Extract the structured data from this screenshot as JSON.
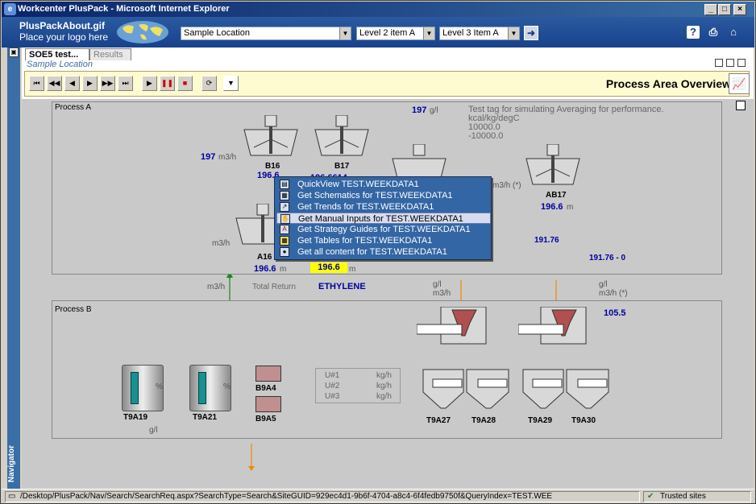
{
  "window": {
    "title": "Workcenter PlusPack - Microsoft Internet Explorer"
  },
  "header": {
    "logo_file": "PlusPackAbout.gif",
    "logo_text": "Place your logo here",
    "location": "Sample Location",
    "level2": "Level 2 item A",
    "level3": "Level 3 Item A"
  },
  "tabs": [
    {
      "label": "SOE5 test..."
    },
    {
      "label": "Results"
    }
  ],
  "sub_location": "Sample Location",
  "toolbar_title": "Process Area Overview",
  "navigator": "Navigator",
  "process_a": {
    "label": "Process A",
    "flow_197_left": "197",
    "unit_m3h": "m3/h",
    "b16": "B16",
    "b17": "B17",
    "a16": "A16",
    "ab17": "AB17",
    "v196_6": "196.6",
    "v196_6614": "196.6614",
    "top_197": "197",
    "top_gl": "g/l",
    "test_note": "Test tag for simulating Averaging for performance.",
    "note_unit": "kcal/kg/degC",
    "note_hi": "10000.0",
    "note_lo": "-10000.0",
    "m3h_star": "m3/h (*)",
    "right_196_6": "196.6",
    "right_m": "m",
    "v191_76": "191.76",
    "v191_76_0": "191.76 - 0",
    "left_m3h": "m3/h",
    "bottom_196_6": "196.6",
    "bottom_m": "m",
    "yellow_196_6": "196.6",
    "yellow_m": "m"
  },
  "mid": {
    "m3h": "m3/h",
    "total_return": "Total Return",
    "ethylene": "ETHYLENE",
    "gl_left": "g/l",
    "m3h_left": "m3/h",
    "gl_right": "g/l",
    "m3h_right_star": "m3/h (*)"
  },
  "process_b": {
    "label": "Process B",
    "v105_5": "105.5",
    "t9a19": "T9A19",
    "t9a21": "T9A21",
    "b9a4": "B9A4",
    "b9a5": "B9A5",
    "t9a27": "T9A27",
    "t9a28": "T9A28",
    "t9a29": "T9A29",
    "t9a30": "T9A30",
    "pct": "%",
    "gl": "g/l",
    "u1": "U#1",
    "u2": "U#2",
    "u3": "U#3",
    "kgh": "kg/h"
  },
  "context_menu": [
    {
      "label": "QuickView TEST.WEEKDATA1",
      "icon": "quickview-icon"
    },
    {
      "label": "Get Schematics for TEST.WEEKDATA1",
      "icon": "schematics-icon"
    },
    {
      "label": "Get Trends for TEST.WEEKDATA1",
      "icon": "trend-icon"
    },
    {
      "label": "Get Manual Inputs for TEST.WEEKDATA1",
      "icon": "hand-icon"
    },
    {
      "label": "Get Strategy Guides for TEST.WEEKDATA1",
      "icon": "pdf-icon"
    },
    {
      "label": "Get Tables for TEST.WEEKDATA1",
      "icon": "table-icon"
    },
    {
      "label": "Get all content for TEST.WEEKDATA1",
      "icon": "globe-icon"
    }
  ],
  "status": {
    "url": "/Desktop/PlusPack/Nav/Search/SearchReq.aspx?SearchType=Search&SiteGUID=929ec4d1-9b6f-4704-a8c4-6f4fedb9750f&QueryIndex=TEST.WEE",
    "zone": "Trusted sites"
  },
  "colors": {
    "header": "#2b5aa0",
    "menu": "#3366a4",
    "flow_orange": "#f08a00",
    "flow_green": "#1a8a1a",
    "value_blue": "#0000a0"
  }
}
